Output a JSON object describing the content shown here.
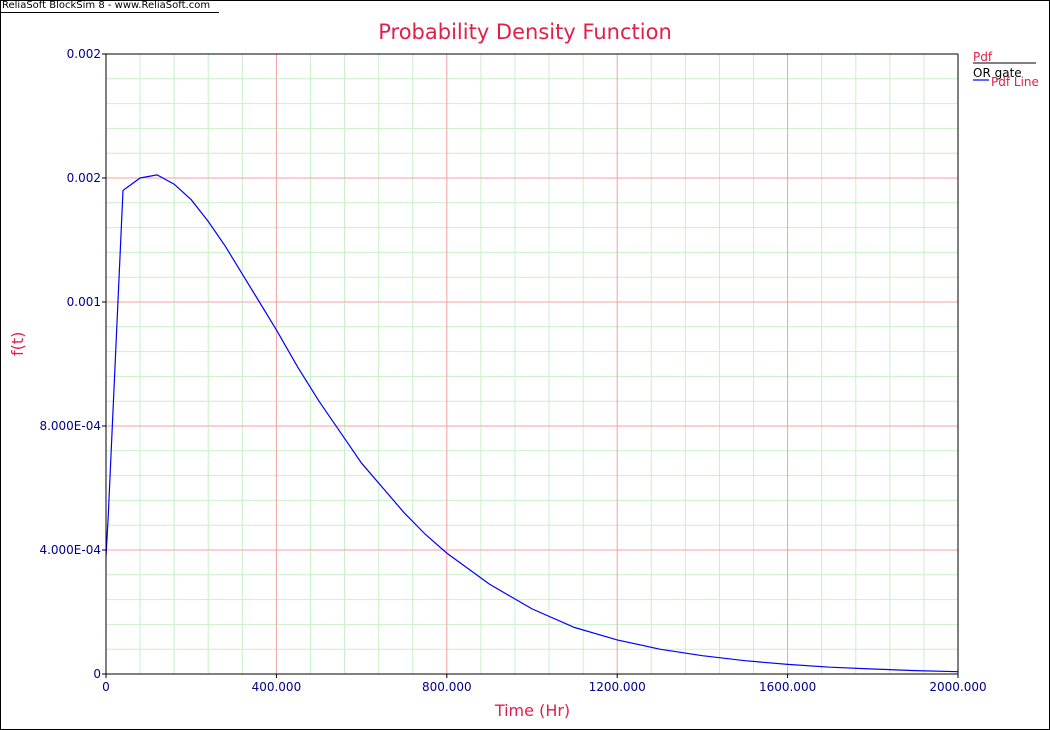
{
  "app_caption": "ReliaSoft BlockSim 8 - www.ReliaSoft.com",
  "colors": {
    "title": "#e0204a",
    "axis_text": "#00008b",
    "major_grid": "#f4a0a0",
    "minor_grid": "#c8f0c8",
    "series": "#0000ff"
  },
  "chart_data": {
    "type": "line",
    "title": "Probability Density Function",
    "xlabel": "Time (Hr)",
    "ylabel": "f(t)",
    "xlim": [
      0,
      2000
    ],
    "ylim": [
      0,
      0.002
    ],
    "grid": true,
    "legend_position": "top-right",
    "x_ticks": [
      "0",
      "400.000",
      "800.000",
      "1200.000",
      "1600.000",
      "2000.000"
    ],
    "y_ticks": [
      "0",
      "4.000E-04",
      "8.000E-04",
      "0.001",
      "0.002",
      "0.002"
    ],
    "legend": {
      "title": "Pdf",
      "entries": [
        {
          "label": "OR gate",
          "color": "#000000"
        },
        {
          "label": "Pdf Line",
          "color": "#e0204a"
        }
      ]
    },
    "series": [
      {
        "name": "Pdf Line",
        "color": "#0000ff",
        "x": [
          0,
          5,
          40,
          80,
          120,
          160,
          200,
          240,
          280,
          320,
          360,
          400,
          450,
          500,
          550,
          600,
          650,
          700,
          750,
          800,
          850,
          900,
          950,
          1000,
          1100,
          1200,
          1300,
          1400,
          1500,
          1600,
          1700,
          1800,
          1900,
          2000
        ],
        "y": [
          0.00038,
          0.0005,
          0.00156,
          0.0016,
          0.00161,
          0.00158,
          0.00153,
          0.00146,
          0.00138,
          0.00129,
          0.0012,
          0.00111,
          0.00099,
          0.00088,
          0.00078,
          0.00068,
          0.0006,
          0.00052,
          0.00045,
          0.00039,
          0.00034,
          0.00029,
          0.00025,
          0.00021,
          0.00015,
          0.00011,
          8e-05,
          5.9e-05,
          4.3e-05,
          3.1e-05,
          2.2e-05,
          1.6e-05,
          1.1e-05,
          7.5e-06
        ]
      }
    ]
  }
}
